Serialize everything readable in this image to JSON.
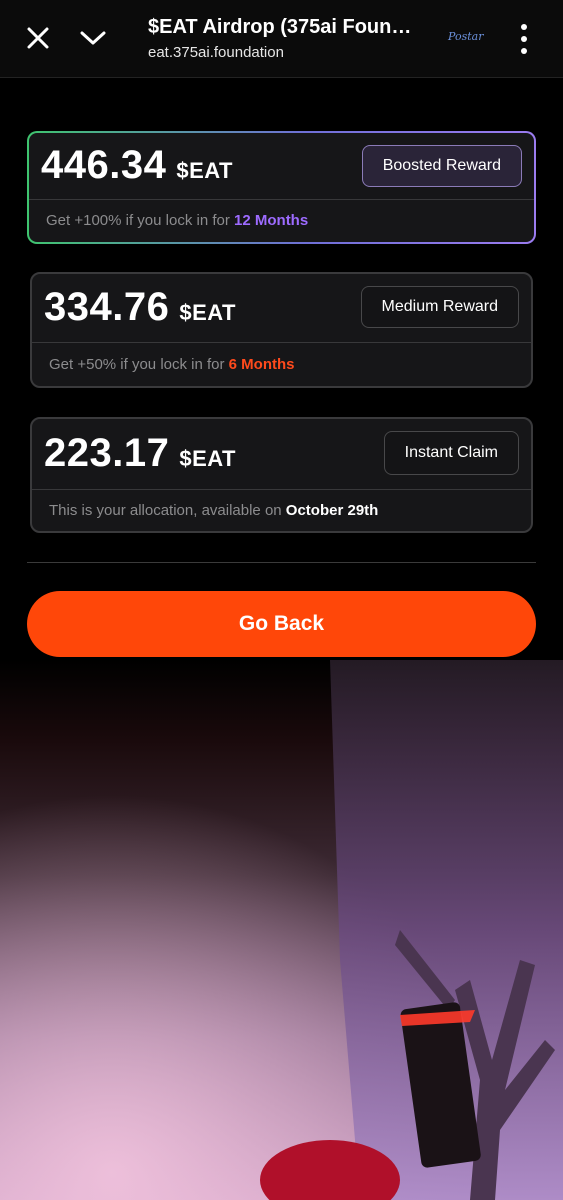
{
  "browser": {
    "title": "$EAT Airdrop (375ai Founda...",
    "url": "eat.375ai.foundation",
    "badge": "Postar",
    "icons": {
      "close": "close-icon",
      "collapse": "chevron-down-icon",
      "menu": "more-vertical-icon"
    }
  },
  "rewards": [
    {
      "amount": "446.34",
      "unit": "$EAT",
      "button": "Boosted Reward",
      "note_prefix": "Get +100% if you lock in for ",
      "note_highlight": "12 Months",
      "highlight_color": "#9d6bff"
    },
    {
      "amount": "334.76",
      "unit": "$EAT",
      "button": "Medium Reward",
      "note_prefix": "Get +50% if you lock in for ",
      "note_highlight": "6 Months",
      "highlight_color": "#ff4a1c"
    },
    {
      "amount": "223.17",
      "unit": "$EAT",
      "button": "Instant Claim",
      "note_prefix": "This is your allocation, available on ",
      "note_highlight": "October 29th",
      "highlight_color": "#ffffff"
    }
  ],
  "actions": {
    "go_back": "Go Back"
  },
  "colors": {
    "accent": "#ff4709",
    "background": "#000000",
    "card": "#161618"
  }
}
